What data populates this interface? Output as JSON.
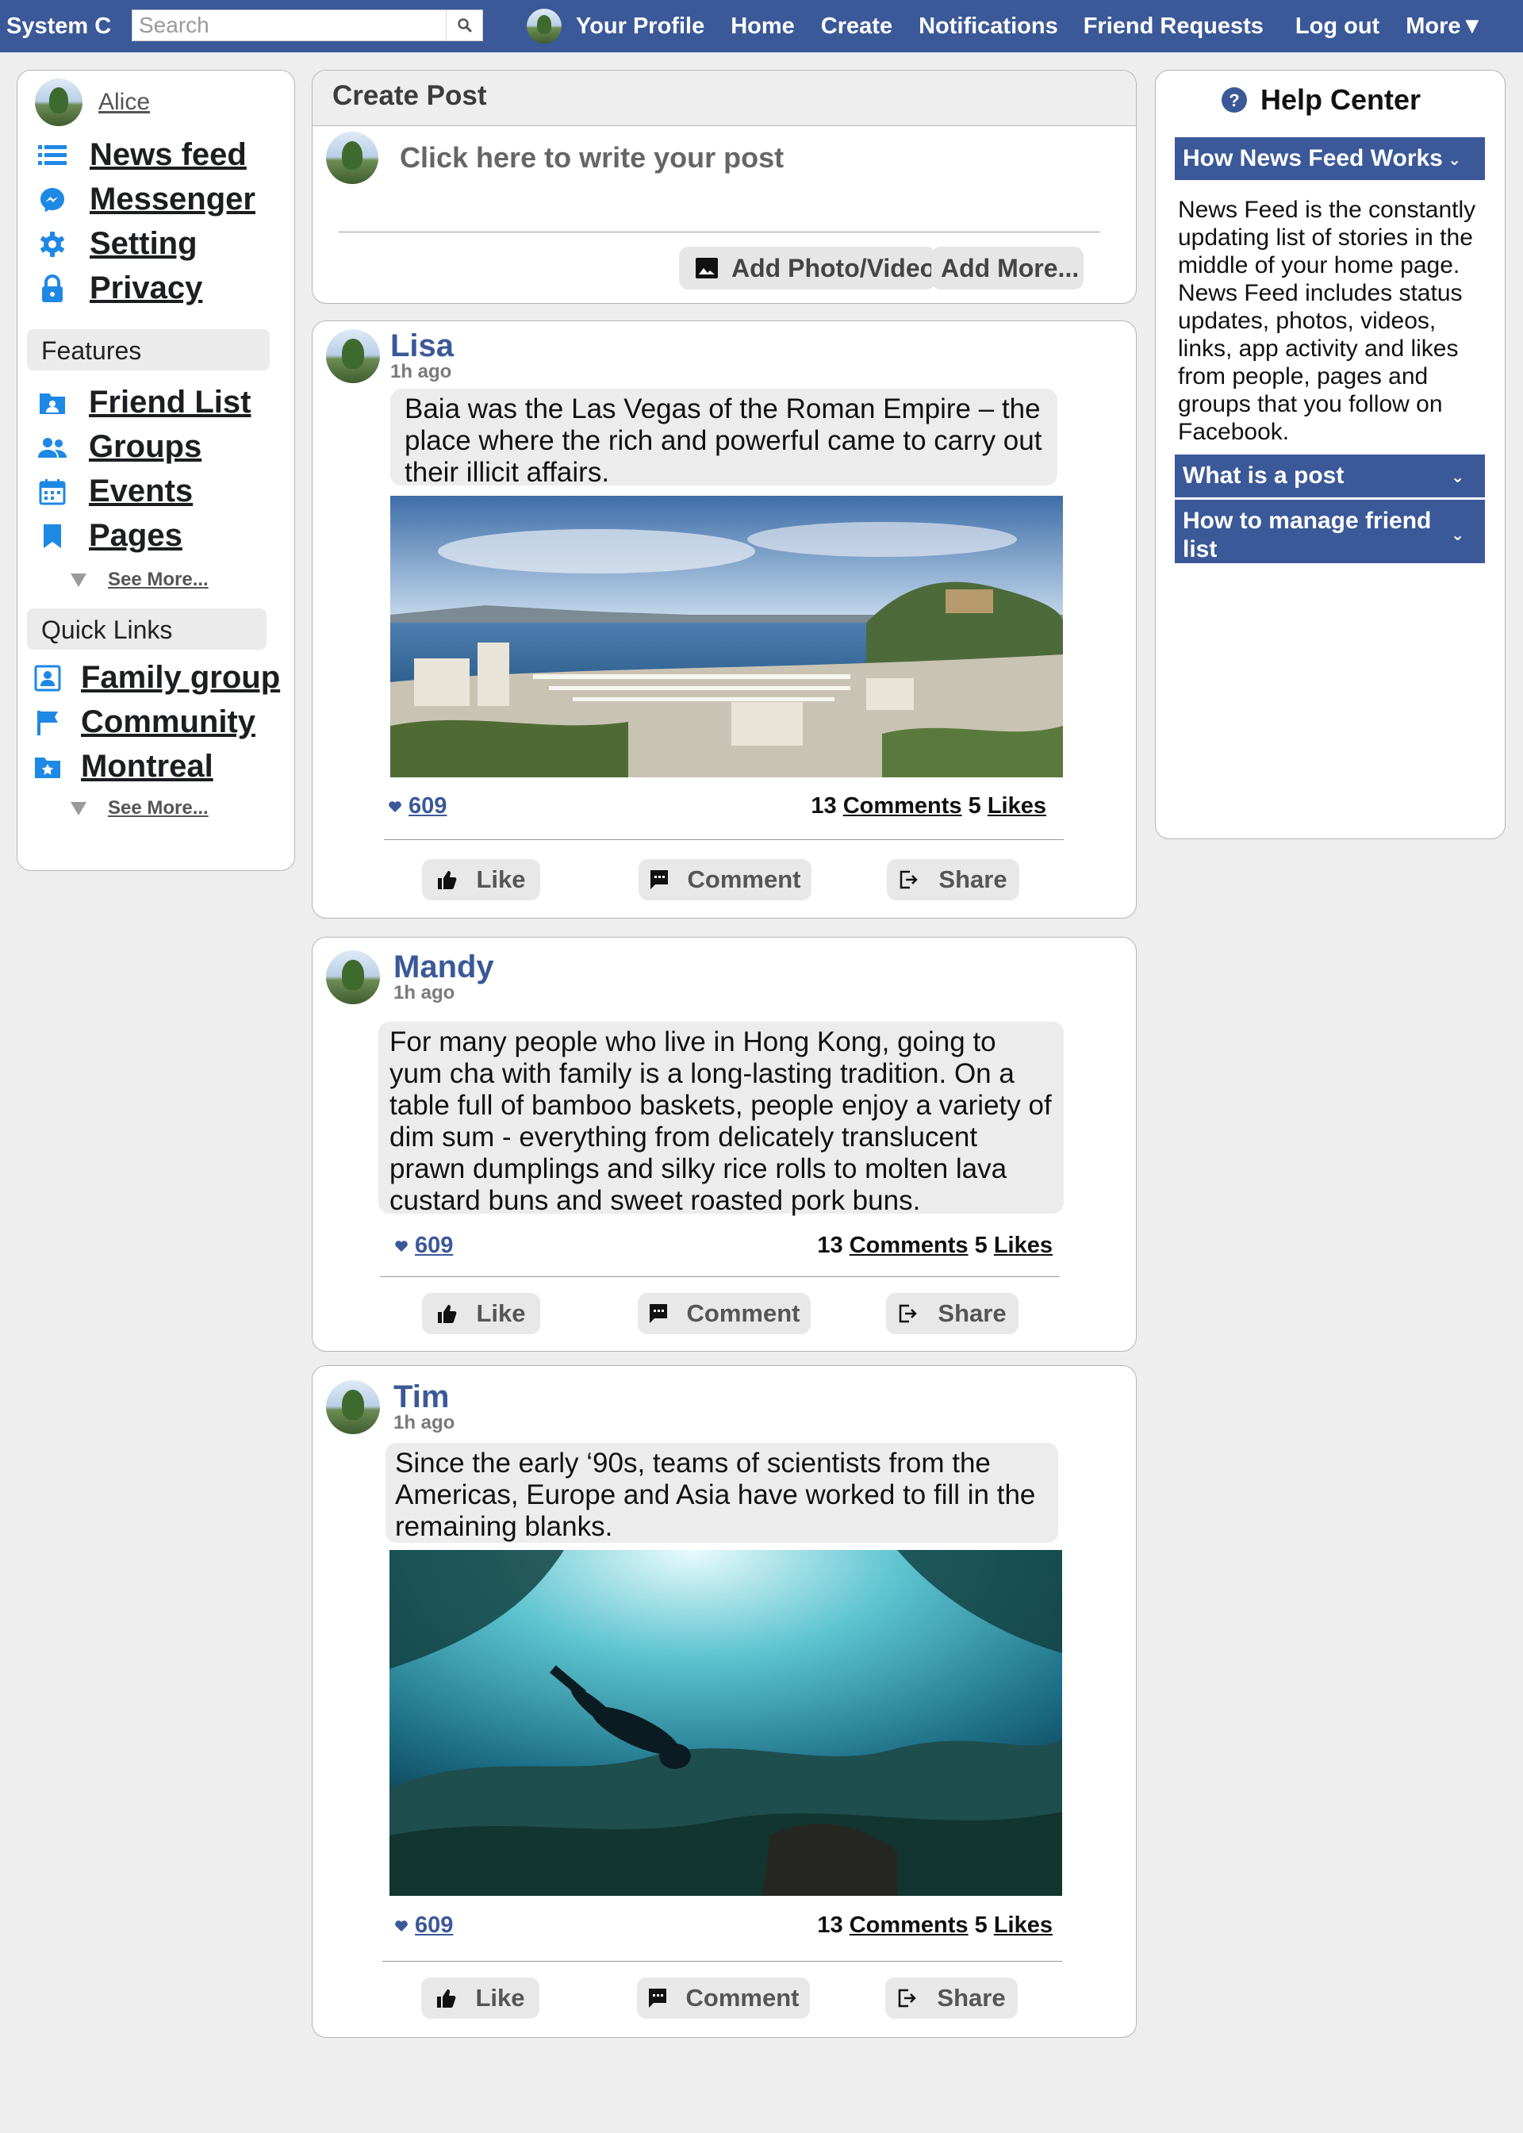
{
  "app": {
    "title": "System C"
  },
  "search": {
    "placeholder": "Search"
  },
  "nav": {
    "profile": "Your Profile",
    "home": "Home",
    "create": "Create",
    "notifications": "Notifications",
    "friend_requests": "Friend Requests",
    "logout": "Log out",
    "more": "More▼"
  },
  "sidebar": {
    "user_name": "Alice",
    "items": [
      {
        "label": "News feed",
        "icon": "news-feed-icon"
      },
      {
        "label": "Messenger",
        "icon": "messenger-icon"
      },
      {
        "label": "Setting",
        "icon": "gear-icon"
      },
      {
        "label": "Privacy",
        "icon": "lock-icon"
      }
    ],
    "features_title": "Features",
    "features": [
      {
        "label": "Friend List",
        "icon": "friend-folder-icon"
      },
      {
        "label": "Groups",
        "icon": "groups-icon"
      },
      {
        "label": "Events",
        "icon": "calendar-icon"
      },
      {
        "label": "Pages",
        "icon": "bookmark-icon"
      }
    ],
    "see_more_1": "See More...",
    "quick_links_title": "Quick Links",
    "quick_links": [
      {
        "label": "Family group",
        "icon": "contact-icon"
      },
      {
        "label": "Community",
        "icon": "flag-icon"
      },
      {
        "label": "Montreal",
        "icon": "star-folder-icon"
      }
    ],
    "see_more_2": "See More..."
  },
  "create_post": {
    "title": "Create Post",
    "placeholder": "Click here to write your post",
    "add_photo": "Add Photo/Video",
    "add_more": "Add More..."
  },
  "posts": [
    {
      "author": "Lisa",
      "time": "1h ago",
      "text": "Baia was the Las Vegas of the Roman Empire – the place where the rich and powerful came to carry out their illicit affairs.",
      "hearts": "609",
      "comments_count": "13",
      "comments_label": "Comments",
      "likes_count": "5",
      "likes_label": "Likes"
    },
    {
      "author": "Mandy",
      "time": "1h ago",
      "text": "For many people who live in Hong Kong, going to yum cha with family is a long-lasting tradition.  On a table full of bamboo baskets, people enjoy a variety of dim sum - everything from delicately translucent prawn dumplings and silky rice rolls to molten lava custard buns and sweet roasted pork buns.",
      "hearts": "609",
      "comments_count": "13",
      "comments_label": "Comments",
      "likes_count": "5",
      "likes_label": "Likes"
    },
    {
      "author": "Tim",
      "time": "1h ago",
      "text": "Since the early ‘90s, teams of scientists from the Americas, Europe and Asia have worked to fill in the remaining blanks.",
      "hearts": "609",
      "comments_count": "13",
      "comments_label": "Comments",
      "likes_count": "5",
      "likes_label": "Likes"
    }
  ],
  "actions": {
    "like": "Like",
    "comment": "Comment",
    "share": "Share"
  },
  "help": {
    "title": "Help Center",
    "sections": [
      {
        "title": "How News Feed Works"
      },
      {
        "title": "What is a post"
      },
      {
        "title": "How to manage friend list"
      }
    ],
    "body": "News Feed is the constantly updating list of stories in the middle of your home page. News Feed includes status updates, photos, videos, links, app activity and likes from people, pages and groups that you follow on Facebook."
  },
  "colors": {
    "brand": "#3b5998",
    "icon_blue": "#1e88e5",
    "page_bg": "#eeeeee"
  }
}
